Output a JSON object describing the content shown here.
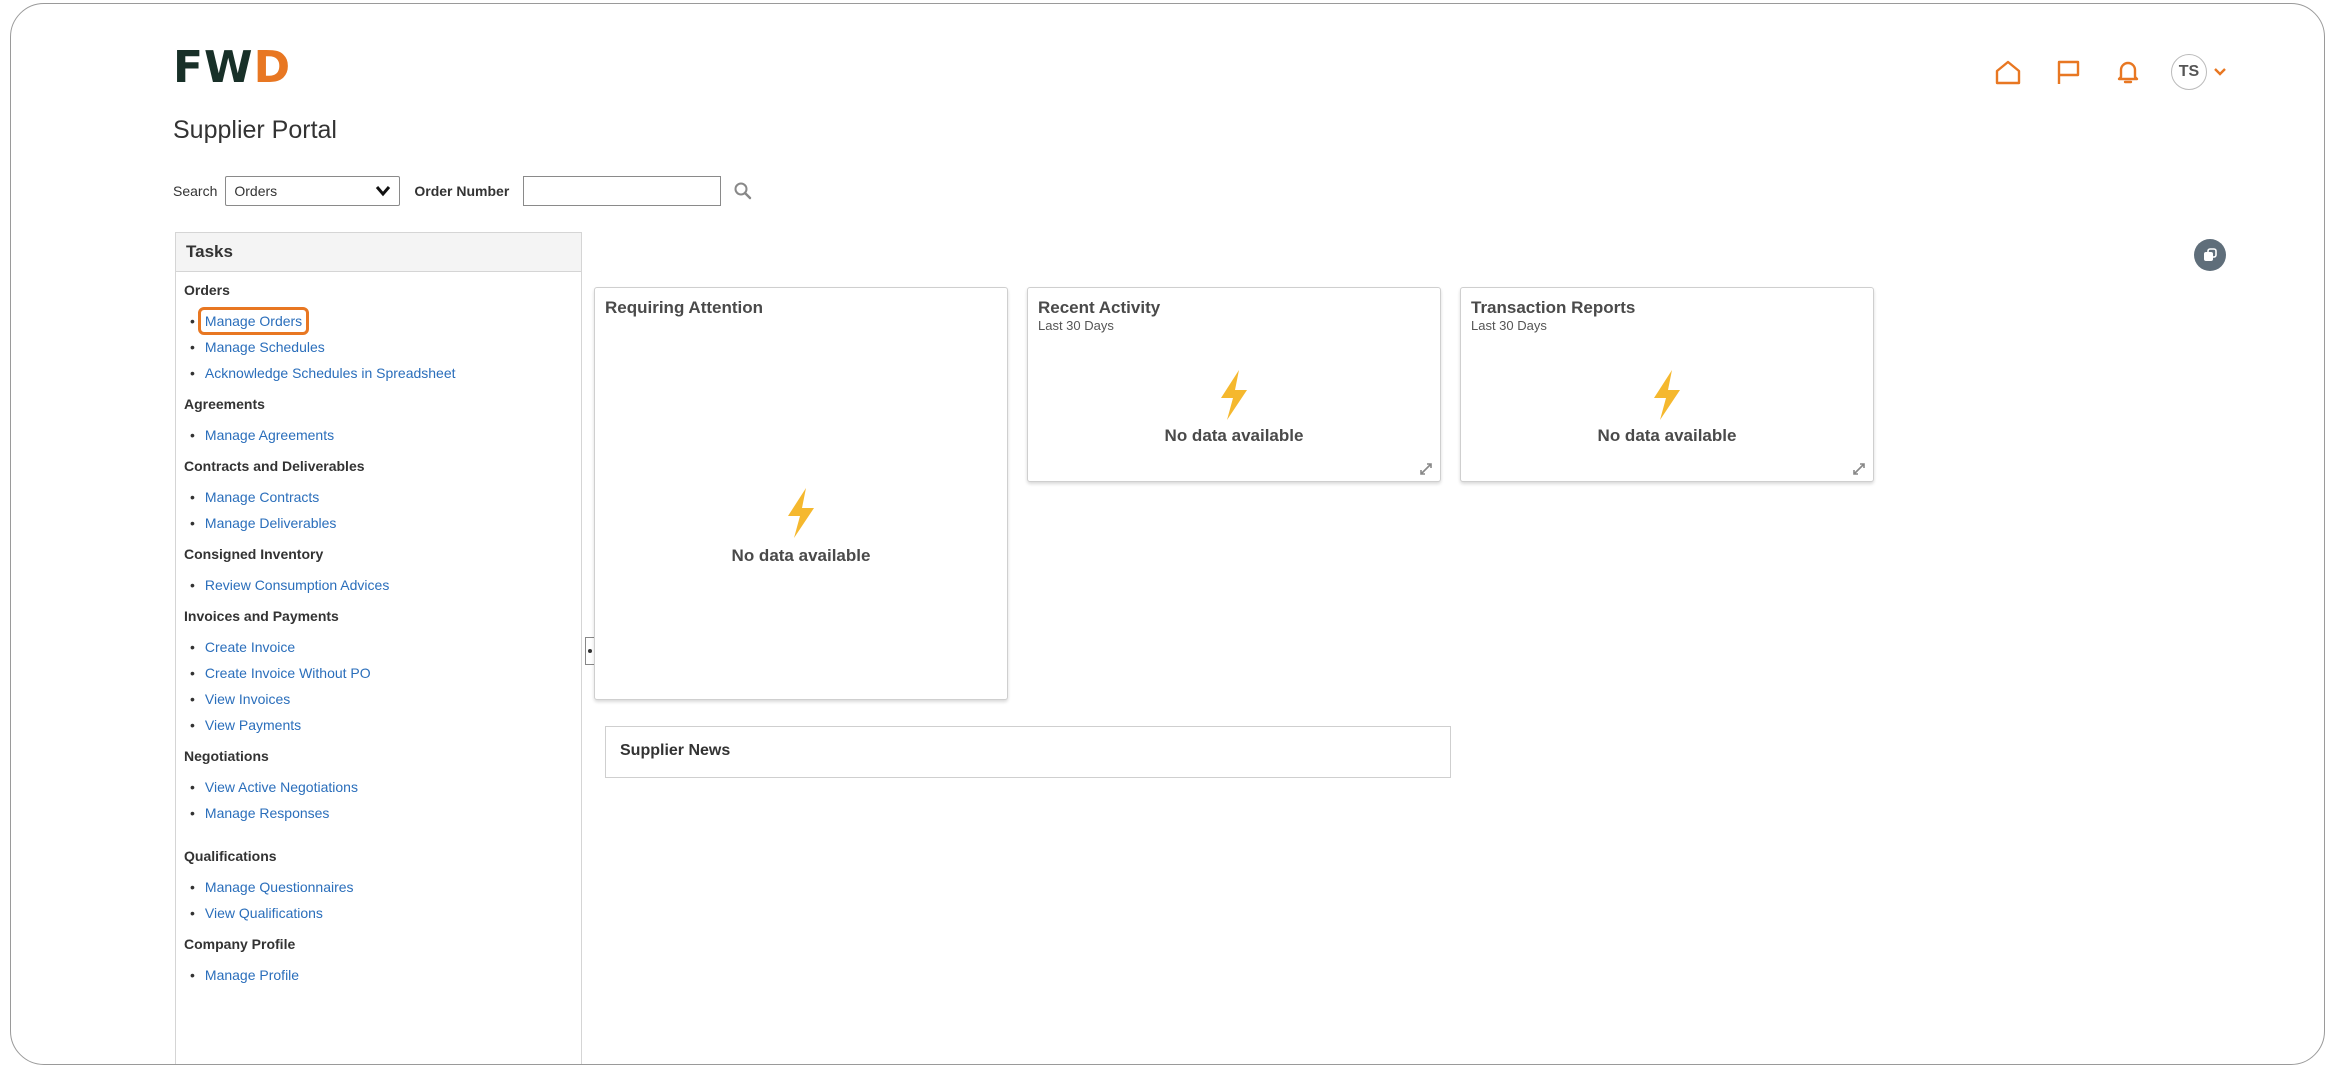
{
  "brand": {
    "logo_text_main": "FW",
    "logo_text_accent": "D"
  },
  "header": {
    "user_initials": "TS"
  },
  "page": {
    "title": "Supplier Portal"
  },
  "search": {
    "label": "Search",
    "scope_value": "Orders",
    "field_label": "Order Number",
    "field_value": ""
  },
  "tasks": {
    "title": "Tasks",
    "sections": [
      {
        "title": "Orders",
        "items": [
          "Manage Orders",
          "Manage Schedules",
          "Acknowledge Schedules in Spreadsheet"
        ]
      },
      {
        "title": "Agreements",
        "items": [
          "Manage Agreements"
        ]
      },
      {
        "title": "Contracts and Deliverables",
        "items": [
          "Manage Contracts",
          "Manage Deliverables"
        ]
      },
      {
        "title": "Consigned Inventory",
        "items": [
          "Review Consumption Advices"
        ]
      },
      {
        "title": "Invoices and Payments",
        "items": [
          "Create Invoice",
          "Create Invoice Without PO",
          "View Invoices",
          "View Payments"
        ]
      },
      {
        "title": "Negotiations",
        "items": [
          "View Active Negotiations",
          "Manage Responses"
        ]
      },
      {
        "title": "Qualifications",
        "items": [
          "Manage Questionnaires",
          "View Qualifications"
        ]
      },
      {
        "title": "Company Profile",
        "items": [
          "Manage Profile"
        ]
      }
    ]
  },
  "tiles": {
    "requiring_attention": {
      "title": "Requiring Attention",
      "empty": "No data available"
    },
    "recent_activity": {
      "title": "Recent Activity",
      "subtitle": "Last 30 Days",
      "empty": "No data available"
    },
    "transaction_reports": {
      "title": "Transaction Reports",
      "subtitle": "Last 30 Days",
      "empty": "No data available"
    }
  },
  "news": {
    "title": "Supplier News"
  },
  "colors": {
    "accent": "#e87722",
    "link": "#2a6ebb",
    "brand_dark": "#183028",
    "bolt": "#f5b82e"
  },
  "icons": [
    "home-icon",
    "flag-icon",
    "bell-icon",
    "chevron-down-icon",
    "search-icon",
    "lightning-icon",
    "expand-icon",
    "personalize-icon"
  ]
}
